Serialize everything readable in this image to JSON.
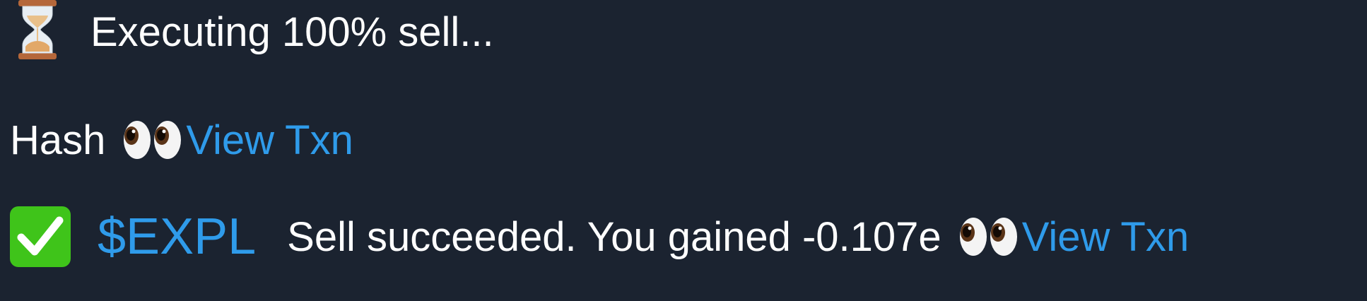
{
  "messages": {
    "executing": {
      "icon": "hourglass-icon",
      "text": "Executing 100% sell..."
    },
    "hash": {
      "label": "Hash",
      "icon": "eyes-icon",
      "link": "View Txn"
    },
    "result": {
      "icon": "check-mark-icon",
      "ticker": "$EXPL",
      "text": "Sell succeeded. You gained -0.107e",
      "eyes_icon": "eyes-icon",
      "link": "View Txn"
    }
  },
  "colors": {
    "background": "#1b2330",
    "text": "#ffffff",
    "link": "#2f9bea",
    "check": "#3fc41a"
  }
}
